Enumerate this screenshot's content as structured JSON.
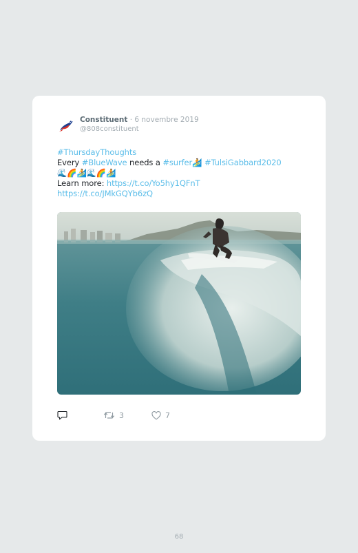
{
  "tweet": {
    "author_name": "Constituent",
    "date": " · 6 novembre 2019",
    "handle": "@808constituent",
    "hashtag_thursday": "#ThursdayThoughts",
    "word_every": "Every ",
    "hashtag_bluewave": "#BlueWave",
    "word_needs": " needs a ",
    "hashtag_surfer": "#surfer",
    "emoji_surfer": "🏄",
    "hashtag_tulsi": "#TulsiGabbard2020",
    "emoji_row": "🌊🌈🏄🌊🌈🏄",
    "learn_more": "Learn more: ",
    "link_1": "https://t.co/Yo5hy1QFnT",
    "link_2": "https://t.co/JMkGQYb6zQ"
  },
  "actions": {
    "reply_icon": "reply-icon",
    "retweet_icon": "retweet-icon",
    "retweet_count": "3",
    "like_icon": "heart-icon",
    "like_count": "7"
  },
  "colors": {
    "link": "#5bbde9",
    "name": "#5c6b74",
    "muted": "#a4adb3",
    "background": "#e6e9ea"
  },
  "page": {
    "number": "68"
  }
}
